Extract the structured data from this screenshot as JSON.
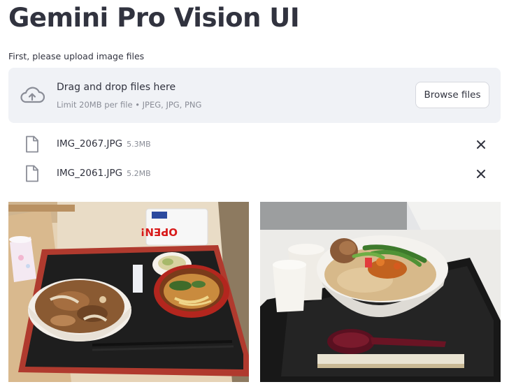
{
  "app": {
    "title": "Gemini Pro Vision UI"
  },
  "uploader": {
    "label": "First, please upload image files",
    "drop_title": "Drag and drop files here",
    "drop_limits": "Limit 20MB per file • JPEG, JPG, PNG",
    "browse_label": "Browse files",
    "upload_icon": "cloud-upload-icon"
  },
  "files": [
    {
      "name": "IMG_2067.JPG",
      "size": "5.3MB",
      "icon": "file-icon",
      "remove_icon": "close-icon"
    },
    {
      "name": "IMG_2061.JPG",
      "size": "5.2MB",
      "icon": "file-icon",
      "remove_icon": "close-icon"
    }
  ],
  "images": {
    "left_sign_text": "OPEN!",
    "colors": {
      "tray_red": "#b03a2e",
      "tray_black": "#1e1e1e",
      "table_wood": "#d9b98e",
      "bowl_white": "#f3efe9",
      "beef": "#8a5a32",
      "broth": "#d7b98a"
    }
  }
}
